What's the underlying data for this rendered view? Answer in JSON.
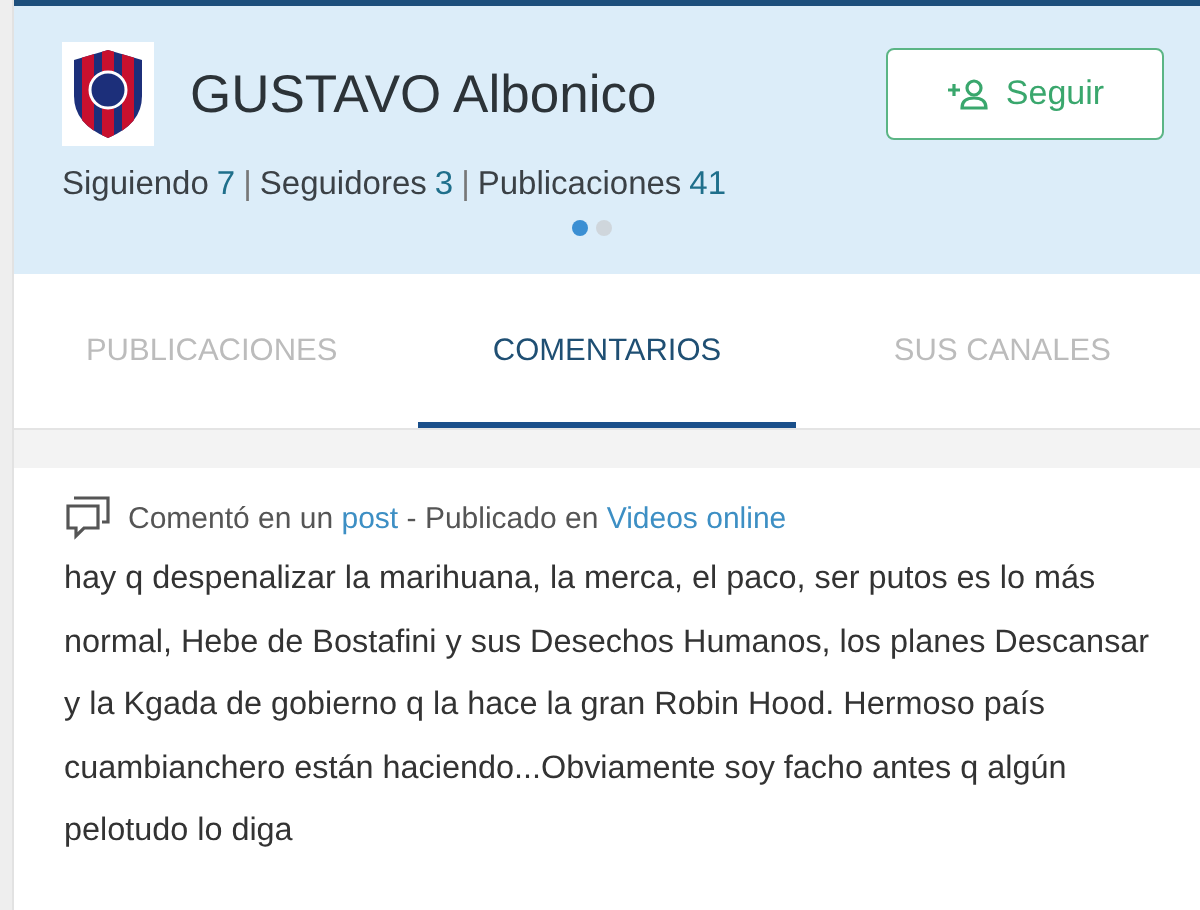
{
  "profile": {
    "name": "GUSTAVO Albonico",
    "follow_button": "Seguir",
    "stats": [
      {
        "label": "Siguiendo",
        "count": "7"
      },
      {
        "label": "Seguidores",
        "count": "3"
      },
      {
        "label": "Publicaciones",
        "count": "41"
      }
    ],
    "separator": "|",
    "pager": [
      {
        "selected": true
      },
      {
        "selected": false
      }
    ]
  },
  "tabs": [
    {
      "label": "PUBLICACIONES",
      "selected": false
    },
    {
      "label": "COMENTARIOS",
      "selected": true
    },
    {
      "label": "SUS CANALES",
      "selected": false
    }
  ],
  "comment": {
    "context": [
      {
        "kind": "text",
        "text": "Comentó en un "
      },
      {
        "kind": "link",
        "text": "post"
      },
      {
        "kind": "text",
        "text": " - Publicado en "
      },
      {
        "kind": "link",
        "text": "Videos online"
      }
    ],
    "body": "hay q despenalizar la marihuana, la merca, el paco, ser putos es lo más normal, Hebe de Bostafini y sus Desechos Humanos, los planes Descansar y la Kgada de gobierno q la hace la gran Robin Hood. Hermoso país cuambianchero están haciendo...Obviamente soy facho antes q algún pelotudo lo diga"
  }
}
